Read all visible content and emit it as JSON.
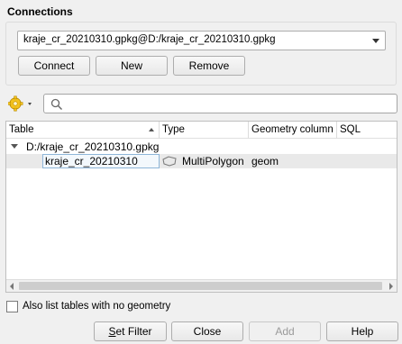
{
  "connections": {
    "title": "Connections",
    "selected": "kraje_cr_20210310.gpkg@D:/kraje_cr_20210310.gpkg",
    "buttons": {
      "connect": "Connect",
      "new": "New",
      "remove": "Remove"
    }
  },
  "search": {
    "placeholder": "",
    "icon": "search-icon"
  },
  "table": {
    "columns": [
      "Table",
      "Type",
      "Geometry column",
      "SQL"
    ],
    "group": "D:/kraje_cr_20210310.gpkg",
    "rows": [
      {
        "table": "kraje_cr_20210310",
        "type": "MultiPolygon",
        "geometry_column": "geom",
        "sql": ""
      }
    ]
  },
  "options": {
    "no_geometry_label": "Also list tables with no geometry",
    "no_geometry_checked": false
  },
  "footer": {
    "set_filter": "Set Filter",
    "close": "Close",
    "add": "Add",
    "help": "Help"
  }
}
